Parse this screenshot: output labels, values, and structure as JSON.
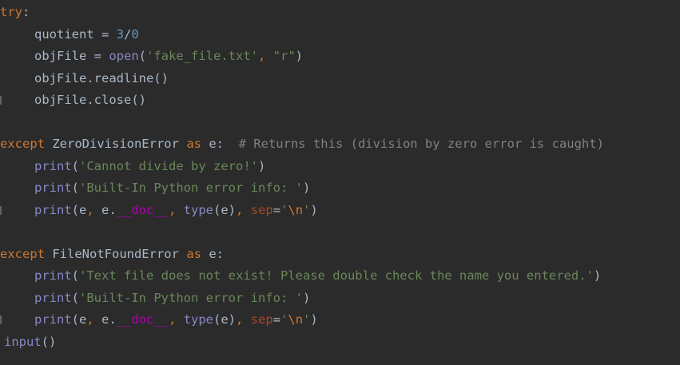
{
  "lines": [
    {
      "tokens": [
        {
          "t": "try",
          "c": "kw"
        },
        {
          "t": ":",
          "c": "plain"
        }
      ]
    },
    {
      "tokens": [
        {
          "t": "quotient = ",
          "c": "plain"
        },
        {
          "t": "3",
          "c": "num"
        },
        {
          "t": "/",
          "c": "plain"
        },
        {
          "t": "0",
          "c": "num"
        }
      ]
    },
    {
      "tokens": [
        {
          "t": "objFile = ",
          "c": "plain"
        },
        {
          "t": "open",
          "c": "bi"
        },
        {
          "t": "(",
          "c": "plain"
        },
        {
          "t": "'fake_file.txt'",
          "c": "str"
        },
        {
          "t": ", ",
          "c": "kw"
        },
        {
          "t": "\"r\"",
          "c": "str"
        },
        {
          "t": ")",
          "c": "plain"
        }
      ]
    },
    {
      "tokens": [
        {
          "t": "objFile.readline()",
          "c": "plain"
        }
      ]
    },
    {
      "tokens": [
        {
          "t": "objFile.close()",
          "c": "plain"
        }
      ]
    },
    {
      "tokens": []
    },
    {
      "tokens": [
        {
          "t": "except ",
          "c": "kw"
        },
        {
          "t": "ZeroDivisionError ",
          "c": "plain"
        },
        {
          "t": "as ",
          "c": "kw"
        },
        {
          "t": "e:  ",
          "c": "plain"
        },
        {
          "t": "# Returns this (division by zero error is caught)",
          "c": "cmt"
        }
      ]
    },
    {
      "tokens": [
        {
          "t": "print",
          "c": "bi"
        },
        {
          "t": "(",
          "c": "plain"
        },
        {
          "t": "'Cannot divide by zero!'",
          "c": "str"
        },
        {
          "t": ")",
          "c": "plain"
        }
      ]
    },
    {
      "tokens": [
        {
          "t": "print",
          "c": "bi"
        },
        {
          "t": "(",
          "c": "plain"
        },
        {
          "t": "'Built-In Python error info: '",
          "c": "str"
        },
        {
          "t": ")",
          "c": "plain"
        }
      ]
    },
    {
      "tokens": [
        {
          "t": "print",
          "c": "bi"
        },
        {
          "t": "(e",
          "c": "plain"
        },
        {
          "t": ", ",
          "c": "kw"
        },
        {
          "t": "e.",
          "c": "plain"
        },
        {
          "t": "__doc__",
          "c": "dunder"
        },
        {
          "t": ", ",
          "c": "kw"
        },
        {
          "t": "type",
          "c": "bi"
        },
        {
          "t": "(e)",
          "c": "plain"
        },
        {
          "t": ", ",
          "c": "kw"
        },
        {
          "t": "sep",
          "c": "param"
        },
        {
          "t": "=",
          "c": "plain"
        },
        {
          "t": "'",
          "c": "str"
        },
        {
          "t": "\\n",
          "c": "esc"
        },
        {
          "t": "'",
          "c": "str"
        },
        {
          "t": ")",
          "c": "plain"
        }
      ]
    },
    {
      "tokens": []
    },
    {
      "tokens": [
        {
          "t": "except ",
          "c": "kw"
        },
        {
          "t": "FileNotFoundError ",
          "c": "plain"
        },
        {
          "t": "as ",
          "c": "kw"
        },
        {
          "t": "e:",
          "c": "plain"
        }
      ]
    },
    {
      "tokens": [
        {
          "t": "print",
          "c": "bi"
        },
        {
          "t": "(",
          "c": "plain"
        },
        {
          "t": "'Text file does not exist! Please double check the name you entered.'",
          "c": "str"
        },
        {
          "t": ")",
          "c": "plain"
        }
      ]
    },
    {
      "tokens": [
        {
          "t": "print",
          "c": "bi"
        },
        {
          "t": "(",
          "c": "plain"
        },
        {
          "t": "'Built-In Python error info: '",
          "c": "str"
        },
        {
          "t": ")",
          "c": "plain"
        }
      ]
    },
    {
      "tokens": [
        {
          "t": "print",
          "c": "bi"
        },
        {
          "t": "(e",
          "c": "plain"
        },
        {
          "t": ", ",
          "c": "kw"
        },
        {
          "t": "e.",
          "c": "plain"
        },
        {
          "t": "__doc__",
          "c": "dunder"
        },
        {
          "t": ", ",
          "c": "kw"
        },
        {
          "t": "type",
          "c": "bi"
        },
        {
          "t": "(e)",
          "c": "plain"
        },
        {
          "t": ", ",
          "c": "kw"
        },
        {
          "t": "sep",
          "c": "param"
        },
        {
          "t": "=",
          "c": "plain"
        },
        {
          "t": "'",
          "c": "str"
        },
        {
          "t": "\\n",
          "c": "esc"
        },
        {
          "t": "'",
          "c": "str"
        },
        {
          "t": ")",
          "c": "plain"
        }
      ]
    },
    {
      "tokens": [
        {
          "t": "input",
          "c": "bi"
        },
        {
          "t": "()",
          "c": "plain"
        }
      ]
    }
  ],
  "colors": {
    "background": "#2b2b2b",
    "keyword": "#cc7832",
    "string": "#6a8759",
    "number": "#6897bb",
    "comment": "#808080",
    "builtin": "#8888c6",
    "dunder": "#b200b2",
    "param": "#aa4926",
    "text": "#a9b7c6"
  }
}
